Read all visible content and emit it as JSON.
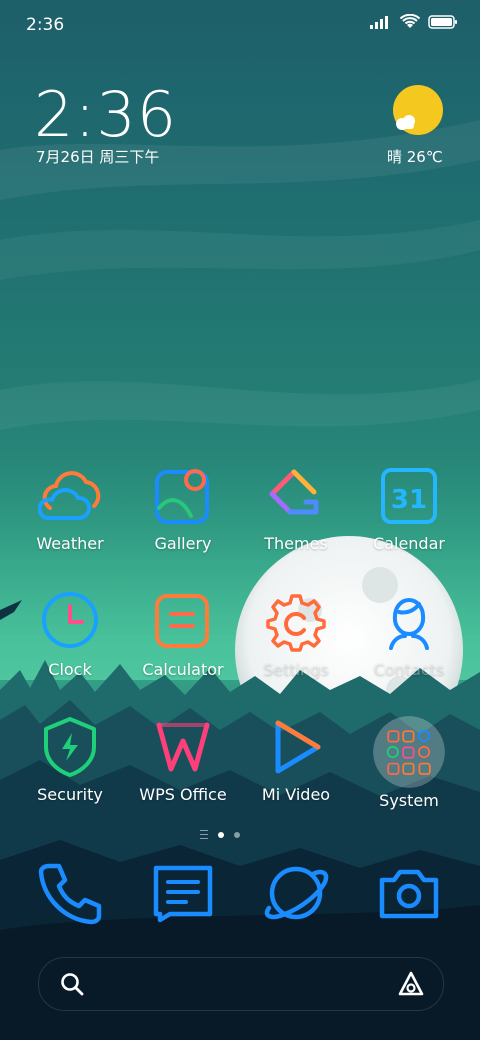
{
  "status_bar": {
    "time": "2:36"
  },
  "clock_widget": {
    "time": "2:36",
    "date": "7月26日 周三下午"
  },
  "weather_widget": {
    "condition_temp": "晴 26℃"
  },
  "apps": [
    {
      "label": "Weather"
    },
    {
      "label": "Gallery"
    },
    {
      "label": "Themes"
    },
    {
      "label": "Calendar",
      "day": "31"
    },
    {
      "label": "Clock"
    },
    {
      "label": "Calculator"
    },
    {
      "label": "Settings"
    },
    {
      "label": "Contacts"
    },
    {
      "label": "Security"
    },
    {
      "label": "WPS Office"
    },
    {
      "label": "Mi Video"
    },
    {
      "label": "System"
    }
  ],
  "page_indicator": {
    "pages": 2,
    "current": 1
  },
  "dock": [
    "phone-icon",
    "messages-icon",
    "browser-icon",
    "camera-icon"
  ],
  "colors": {
    "sun": "#f5c820",
    "accent_blue": "#1a8cff",
    "accent_pink": "#ff4f8b"
  }
}
